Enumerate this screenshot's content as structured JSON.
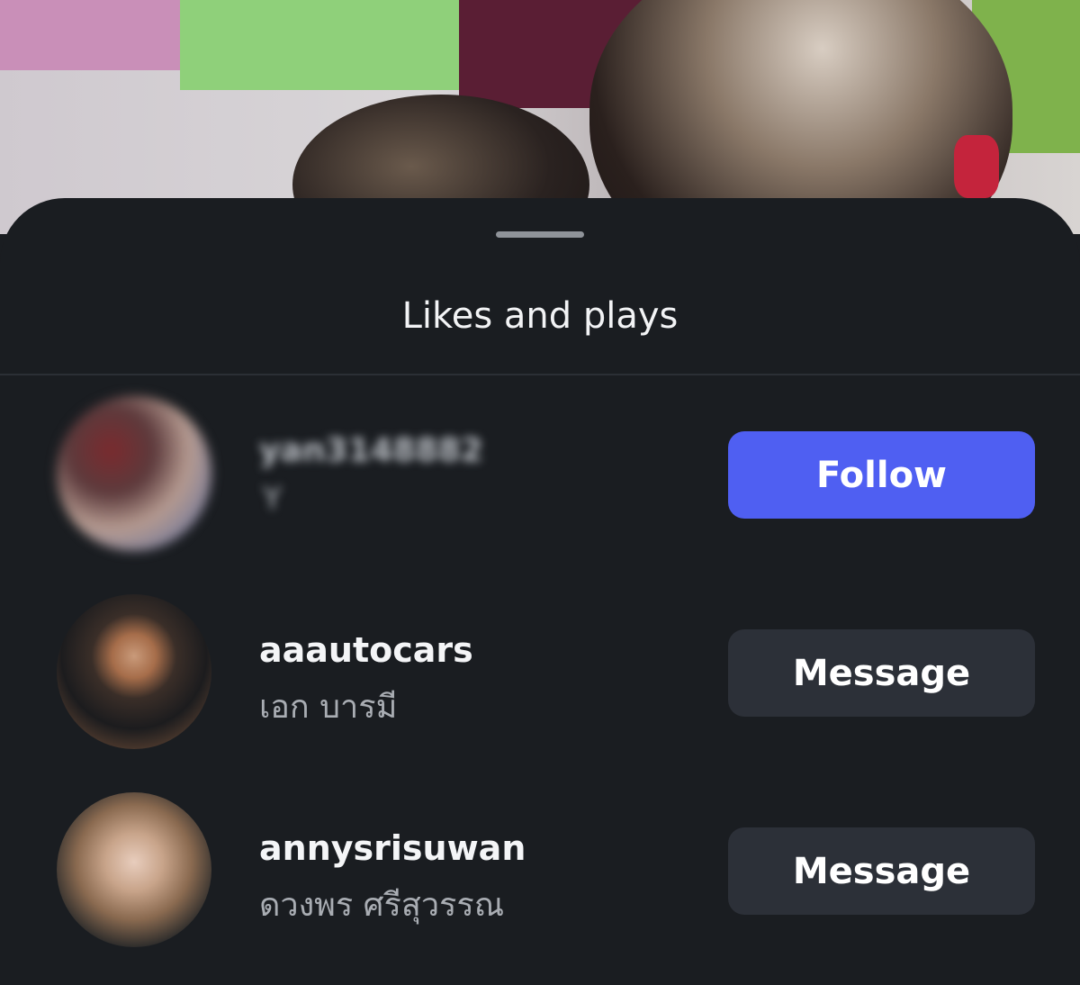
{
  "sheet": {
    "title": "Likes and plays"
  },
  "rows": [
    {
      "username": "yan3148882",
      "fullname": "Y",
      "button_label": "Follow",
      "blurred": true
    },
    {
      "username": "aaautocars",
      "fullname": "เอก บารมี",
      "button_label": "Message"
    },
    {
      "username": "annysrisuwan",
      "fullname": "ดวงพร ศรีสุวรรณ",
      "button_label": "Message"
    }
  ],
  "colors": {
    "sheet_bg": "#1a1d21",
    "follow_button": "#4f5ff2",
    "message_button": "#2c3038",
    "primary_text": "#f4f5f7",
    "secondary_text": "#a9adb3"
  }
}
